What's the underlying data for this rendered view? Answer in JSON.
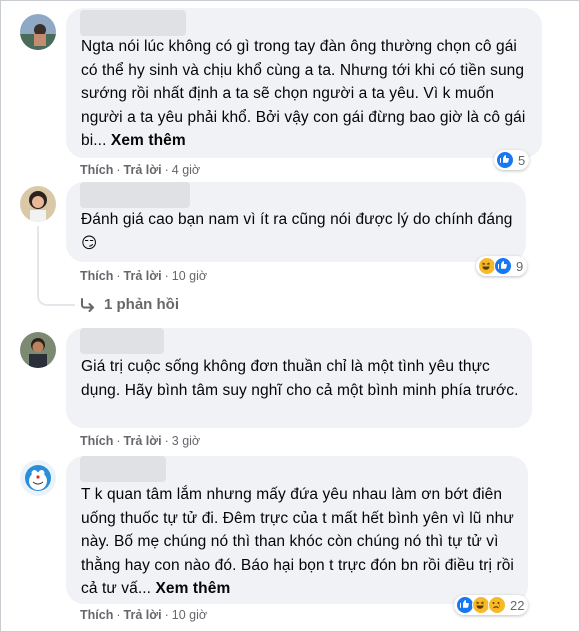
{
  "comments": [
    {
      "text": "Ngta nói lúc không có gì trong tay đàn ông thường chọn cô gái có thể hy sinh và chịu khổ cùng a ta. Nhưng tới khi có tiền sung sướng rồi nhất định a ta sẽ chọn người a ta yêu. Vì k muốn người a ta yêu phải khổ. Bởi vậy con gái đừng bao giờ là cô gái bi... ",
      "see_more": "Xem thêm",
      "like": "Thích",
      "reply": "Trả lời",
      "time": "4 giờ",
      "reaction_count": "5",
      "reactions": [
        "like-icon"
      ]
    },
    {
      "text": "Đánh giá cao bạn nam vì ít ra cũng nói được lý do chính đáng ",
      "emoji": "😏",
      "like": "Thích",
      "reply": "Trả lời",
      "time": "10 giờ",
      "reaction_count": "9",
      "reactions": [
        "haha-icon",
        "like-icon"
      ],
      "replies_link": "1 phản hồi"
    },
    {
      "text": "Giá trị cuộc sống không đơn thuần chỉ là một tình yêu thực dụng. Hãy bình tâm suy nghĩ cho cả một bình minh phía trước.",
      "like": "Thích",
      "reply": "Trả lời",
      "time": "3 giờ"
    },
    {
      "text": "T k quan tâm lắm nhưng mấy đứa yêu nhau làm ơn bớt điên uống thuốc tự tử đi. Đêm trực của t mất hết bình yên vì lũ như này. Bố mẹ chúng nó thì than khóc còn chúng nó thì tự tử vì thằng hay con nào đó. Báo hại bọn t trực đón bn rồi điều trị rồi cả tư vấ... ",
      "see_more": "Xem thêm",
      "like": "Thích",
      "reply": "Trả lời",
      "time": "10 giờ",
      "reaction_count": "22",
      "reactions": [
        "like-icon",
        "haha-icon",
        "sad-icon"
      ]
    }
  ],
  "colors": {
    "bubble": "#f0f2f5",
    "meta": "#65676b",
    "like_blue": "#1877f2",
    "emoji_yellow": "#f7b928"
  }
}
